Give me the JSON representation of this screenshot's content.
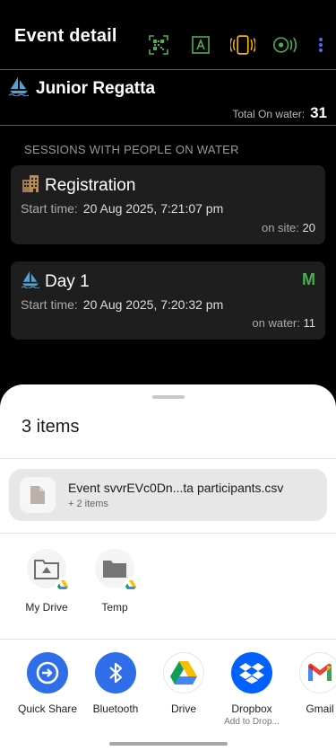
{
  "app_bar": {
    "title": "Event detail",
    "actions": [
      "qr-scan-icon",
      "auto-text-icon",
      "phone-vibrate-icon",
      "nfc-signal-icon",
      "more-vert-icon"
    ],
    "colors": {
      "green": "#4caf50",
      "yellow": "#f9b800",
      "blue": "#4a6cf7"
    }
  },
  "event": {
    "name": "Junior Regatta",
    "icon": "sailboat-icon",
    "total_label": "Total On water:",
    "total_value": "31"
  },
  "sessions_heading": "SESSIONS WITH PEOPLE ON WATER",
  "sessions": [
    {
      "name": "Registration",
      "icon": "building-icon",
      "start_label": "Start time:",
      "start_value": "20 Aug 2025, 7:21:07 pm",
      "count_label": "on site:",
      "count_value": "20",
      "badge": ""
    },
    {
      "name": "Day 1",
      "icon": "sailboat-icon",
      "start_label": "Start time:",
      "start_value": "20 Aug 2025, 7:20:32 pm",
      "count_label": "on water:",
      "count_value": "11",
      "badge": "M"
    }
  ],
  "share_sheet": {
    "title": "3 items",
    "preview": {
      "file_name": "Event svvrEVc0Dn...ta participants.csv",
      "more": "+ 2 items"
    },
    "direct_targets": [
      {
        "label": "My Drive",
        "icon": "shared-folder-icon"
      },
      {
        "label": "Temp",
        "icon": "folder-icon"
      }
    ],
    "apps": [
      {
        "label": "Quick Share",
        "sub": "",
        "icon": "quick-share-icon"
      },
      {
        "label": "Bluetooth",
        "sub": "",
        "icon": "bluetooth-icon"
      },
      {
        "label": "Drive",
        "sub": "",
        "icon": "google-drive-icon"
      },
      {
        "label": "Dropbox",
        "sub": "Add to Drop...",
        "icon": "dropbox-icon"
      },
      {
        "label": "Gmail",
        "sub": "",
        "icon": "gmail-icon"
      }
    ]
  }
}
